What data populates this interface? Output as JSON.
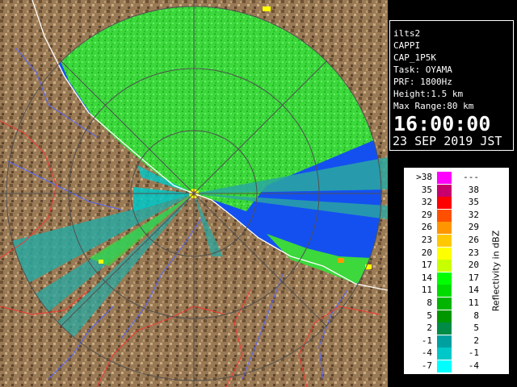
{
  "info": {
    "lines": [
      "ilts2",
      "CAPPI",
      "CAP_1P5K",
      "Task: OYAMA",
      "PRF: 1800Hz",
      "Height:1.5 km",
      "Max Range:80 km"
    ],
    "time": "16:00:00",
    "date": "23 SEP 2019 JST"
  },
  "legend": {
    "label": "Reflectivity in dBZ",
    "rows": [
      {
        "lo": ">38",
        "hi": "---",
        "color": "#ff00ff"
      },
      {
        "lo": "35",
        "hi": "38",
        "color": "#c8006e"
      },
      {
        "lo": "32",
        "hi": "35",
        "color": "#ff0000"
      },
      {
        "lo": "29",
        "hi": "32",
        "color": "#ff5000"
      },
      {
        "lo": "26",
        "hi": "29",
        "color": "#ff9600"
      },
      {
        "lo": "23",
        "hi": "26",
        "color": "#ffc800"
      },
      {
        "lo": "20",
        "hi": "23",
        "color": "#ffff00"
      },
      {
        "lo": "17",
        "hi": "20",
        "color": "#c8ff00"
      },
      {
        "lo": "14",
        "hi": "17",
        "color": "#00ff00"
      },
      {
        "lo": "11",
        "hi": "14",
        "color": "#00dc00"
      },
      {
        "lo": "8",
        "hi": "11",
        "color": "#00b400"
      },
      {
        "lo": "5",
        "hi": "8",
        "color": "#009600"
      },
      {
        "lo": "2",
        "hi": "5",
        "color": "#008c46"
      },
      {
        "lo": "-1",
        "hi": "2",
        "color": "#00a0a0"
      },
      {
        "lo": "-4",
        "hi": "-1",
        "color": "#00c8c8"
      },
      {
        "lo": "-7",
        "hi": "-4",
        "color": "#00ffff"
      }
    ]
  },
  "colors": {
    "sea": "#1450f0",
    "land": "#9a7a55",
    "echo": "#3cd83c",
    "echo_weak": "#2aa8a0",
    "coast": "#ffffff",
    "rivers": "#5566ff",
    "boundaries": "#ff3333",
    "range_rings": "#505050"
  }
}
